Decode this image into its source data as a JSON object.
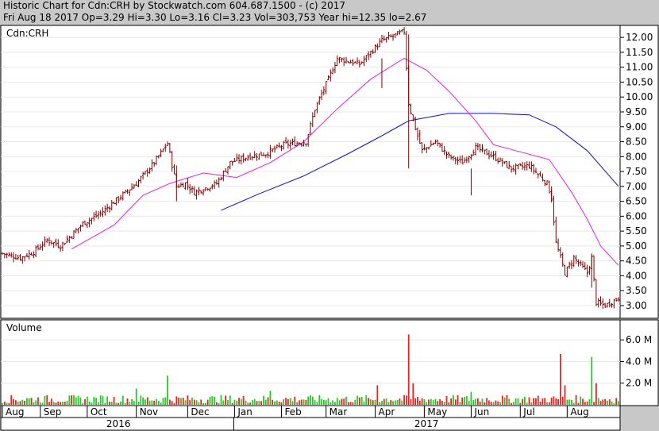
{
  "header": {
    "line1": "Historic Chart for Cdn:CRH by Stockwatch.com 604.687.1500 - (c) 2017",
    "line2": "Fri Aug 18 2017   Op=3.29   Hi=3.30   Lo=3.16   Cl=3.23   Vol=303,753   Year hi=12.35   lo=2.67"
  },
  "colors": {
    "bar": "#800000",
    "ma_short": "#e020e0",
    "ma_long": "#1010c0",
    "vol_up": "#22cc22",
    "vol_down": "#ee2020",
    "background": "#ffffff",
    "frame": "#c8c8c8"
  },
  "chart_data": [
    {
      "type": "line",
      "title": "Cdn:CRH",
      "subtype": "ohlc-bar",
      "ylim": [
        2.6,
        12.35
      ],
      "yticks": [
        "3.00",
        "3.50",
        "4.00",
        "4.50",
        "5.00",
        "5.50",
        "6.00",
        "6.50",
        "7.00",
        "7.50",
        "8.00",
        "8.50",
        "9.00",
        "9.50",
        "10.00",
        "10.50",
        "11.00",
        "11.50",
        "12.00"
      ],
      "xticks": [
        "Aug",
        "Sep",
        "Oct",
        "Nov",
        "Dec",
        "Jan",
        "Feb",
        "Mar",
        "Apr",
        "May",
        "Jun",
        "Jul",
        "Aug"
      ],
      "years": [
        "2016",
        "2017"
      ],
      "close_anchors": [
        [
          0,
          4.75
        ],
        [
          8,
          4.6
        ],
        [
          14,
          4.8
        ],
        [
          20,
          5.2
        ],
        [
          26,
          5.0
        ],
        [
          36,
          5.75
        ],
        [
          44,
          6.1
        ],
        [
          52,
          6.6
        ],
        [
          60,
          7.1
        ],
        [
          68,
          7.8
        ],
        [
          74,
          8.45
        ],
        [
          78,
          7.0
        ],
        [
          82,
          7.1
        ],
        [
          86,
          6.8
        ],
        [
          96,
          7.1
        ],
        [
          102,
          7.8
        ],
        [
          110,
          8.0
        ],
        [
          118,
          8.1
        ],
        [
          126,
          8.4
        ],
        [
          136,
          8.5
        ],
        [
          140,
          9.6
        ],
        [
          146,
          10.6
        ],
        [
          150,
          11.3
        ],
        [
          160,
          11.1
        ],
        [
          170,
          11.9
        ],
        [
          180,
          12.2
        ],
        [
          182,
          9.8
        ],
        [
          184,
          9.2
        ],
        [
          188,
          8.2
        ],
        [
          194,
          8.5
        ],
        [
          200,
          8.0
        ],
        [
          206,
          7.8
        ],
        [
          212,
          8.3
        ],
        [
          220,
          8.0
        ],
        [
          228,
          7.6
        ],
        [
          236,
          7.7
        ],
        [
          244,
          7.1
        ],
        [
          246,
          6.6
        ],
        [
          248,
          5.1
        ],
        [
          252,
          4.1
        ],
        [
          256,
          4.6
        ],
        [
          262,
          4.1
        ],
        [
          264,
          4.6
        ],
        [
          266,
          3.1
        ],
        [
          270,
          3.0
        ],
        [
          276,
          3.25
        ]
      ],
      "ma_short": [
        [
          31,
          4.9
        ],
        [
          50,
          5.7
        ],
        [
          63,
          6.7
        ],
        [
          75,
          7.1
        ],
        [
          90,
          7.45
        ],
        [
          105,
          7.3
        ],
        [
          120,
          7.8
        ],
        [
          135,
          8.5
        ],
        [
          150,
          9.6
        ],
        [
          165,
          10.6
        ],
        [
          180,
          11.3
        ],
        [
          190,
          10.9
        ],
        [
          200,
          10.2
        ],
        [
          212,
          9.2
        ],
        [
          220,
          8.4
        ],
        [
          230,
          8.2
        ],
        [
          245,
          7.9
        ],
        [
          255,
          6.8
        ],
        [
          262,
          5.9
        ],
        [
          268,
          5.0
        ],
        [
          276,
          4.35
        ]
      ],
      "ma_long": [
        [
          98,
          6.2
        ],
        [
          115,
          6.75
        ],
        [
          135,
          7.35
        ],
        [
          155,
          8.1
        ],
        [
          170,
          8.7
        ],
        [
          182,
          9.2
        ],
        [
          200,
          9.45
        ],
        [
          220,
          9.45
        ],
        [
          236,
          9.4
        ],
        [
          248,
          9.0
        ],
        [
          262,
          8.2
        ],
        [
          276,
          7.0
        ]
      ],
      "sessions": 277
    },
    {
      "type": "bar",
      "title": "Volume",
      "ylim": [
        0,
        6.6
      ],
      "yticks": [
        "2.0 M",
        "4.0 M",
        "6.0 M"
      ],
      "spikes": [
        [
          74,
          2.7
        ],
        [
          182,
          6.5
        ],
        [
          184,
          2.0
        ],
        [
          250,
          4.7
        ],
        [
          252,
          1.8
        ],
        [
          264,
          4.4
        ],
        [
          266,
          2.0
        ],
        [
          168,
          1.8
        ],
        [
          120,
          1.3
        ],
        [
          60,
          1.5
        ],
        [
          210,
          1.2
        ]
      ]
    }
  ]
}
